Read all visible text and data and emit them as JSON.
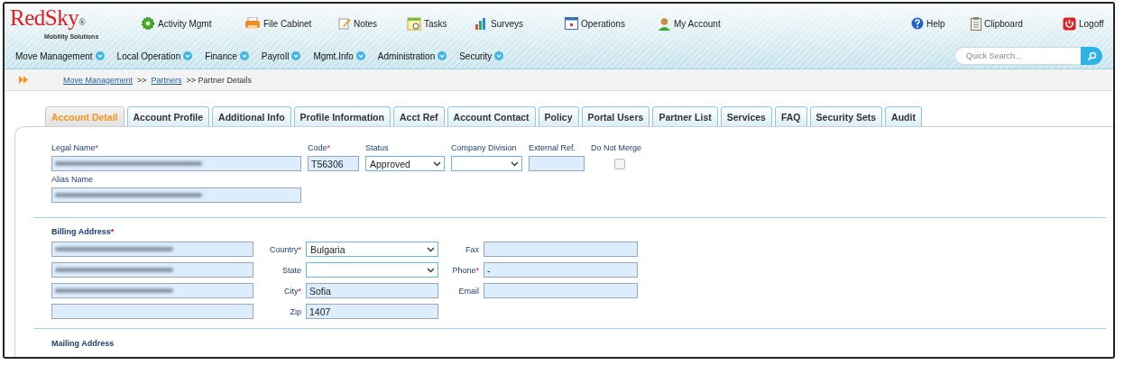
{
  "header": {
    "logo": {
      "name": "RedSky",
      "mark": "®",
      "tagline": "Mobility Solutions"
    },
    "nav": [
      "Activity Mgmt",
      "File Cabinet",
      "Notes",
      "Tasks",
      "Surveys",
      "Operations",
      "My Account"
    ],
    "utility": [
      "Help",
      "Clipboard",
      "Logoff"
    ]
  },
  "menu": [
    "Move Management",
    "Local Operation",
    "Finance",
    "Payroll",
    "Mgmt.Info",
    "Administration",
    "Security"
  ],
  "search": {
    "placeholder": "Quick Search..."
  },
  "breadcrumb": [
    {
      "label": "Move Management",
      "link": true
    },
    {
      "label": ">>",
      "link": false
    },
    {
      "label": "Partners",
      "link": true
    },
    {
      "label": ">> Partner Details",
      "link": false
    }
  ],
  "tabs": [
    {
      "label": "Account Detail",
      "selected": true
    },
    {
      "label": "Account Profile",
      "selected": false
    },
    {
      "label": "Additional Info",
      "selected": false
    },
    {
      "label": "Profile Information",
      "selected": false
    },
    {
      "label": "Acct Ref",
      "selected": false
    },
    {
      "label": "Account Contact",
      "selected": false
    },
    {
      "label": "Policy",
      "selected": false
    },
    {
      "label": "Portal Users",
      "selected": false
    },
    {
      "label": "Partner List",
      "selected": false
    },
    {
      "label": "Services",
      "selected": false
    },
    {
      "label": "FAQ",
      "selected": false
    },
    {
      "label": "Security Sets",
      "selected": false
    },
    {
      "label": "Audit",
      "selected": false
    }
  ],
  "general": {
    "fields": [
      {
        "label": "Legal Name",
        "required_mark": "*",
        "kind": "text",
        "blurred": true
      },
      {
        "label": "Code",
        "required_mark": "*",
        "kind": "text",
        "value": "T56306"
      },
      {
        "label": "Status",
        "kind": "select",
        "value": "Approved"
      },
      {
        "label": "Company Division",
        "kind": "select"
      },
      {
        "label": "External Ref.",
        "kind": "text"
      },
      {
        "label": "Do Not Merge",
        "kind": "checkbox",
        "checked": false
      }
    ],
    "alias": {
      "label": "Alias Name",
      "kind": "text",
      "blurred": true
    }
  },
  "billing": {
    "title": "Billing Address",
    "required_mark": "*",
    "street_lines": [
      {
        "blurred": true
      },
      {
        "blurred": true
      },
      {
        "blurred": true
      },
      {
        "blurred": false
      }
    ],
    "middle": [
      {
        "label": "Country",
        "required_mark": "*",
        "kind": "select",
        "value": "Bulgaria"
      },
      {
        "label": "State",
        "kind": "select"
      },
      {
        "label": "City",
        "required_mark": "*",
        "kind": "text",
        "value": "Sofia"
      },
      {
        "label": "Zip",
        "kind": "text",
        "value": "1407"
      }
    ],
    "right": [
      {
        "label": "Fax",
        "kind": "text"
      },
      {
        "label": "Phone",
        "required_mark": "*",
        "kind": "text",
        "value": "-"
      },
      {
        "label": "Email",
        "kind": "text"
      }
    ]
  },
  "mailing": {
    "title": "Mailing Address"
  }
}
